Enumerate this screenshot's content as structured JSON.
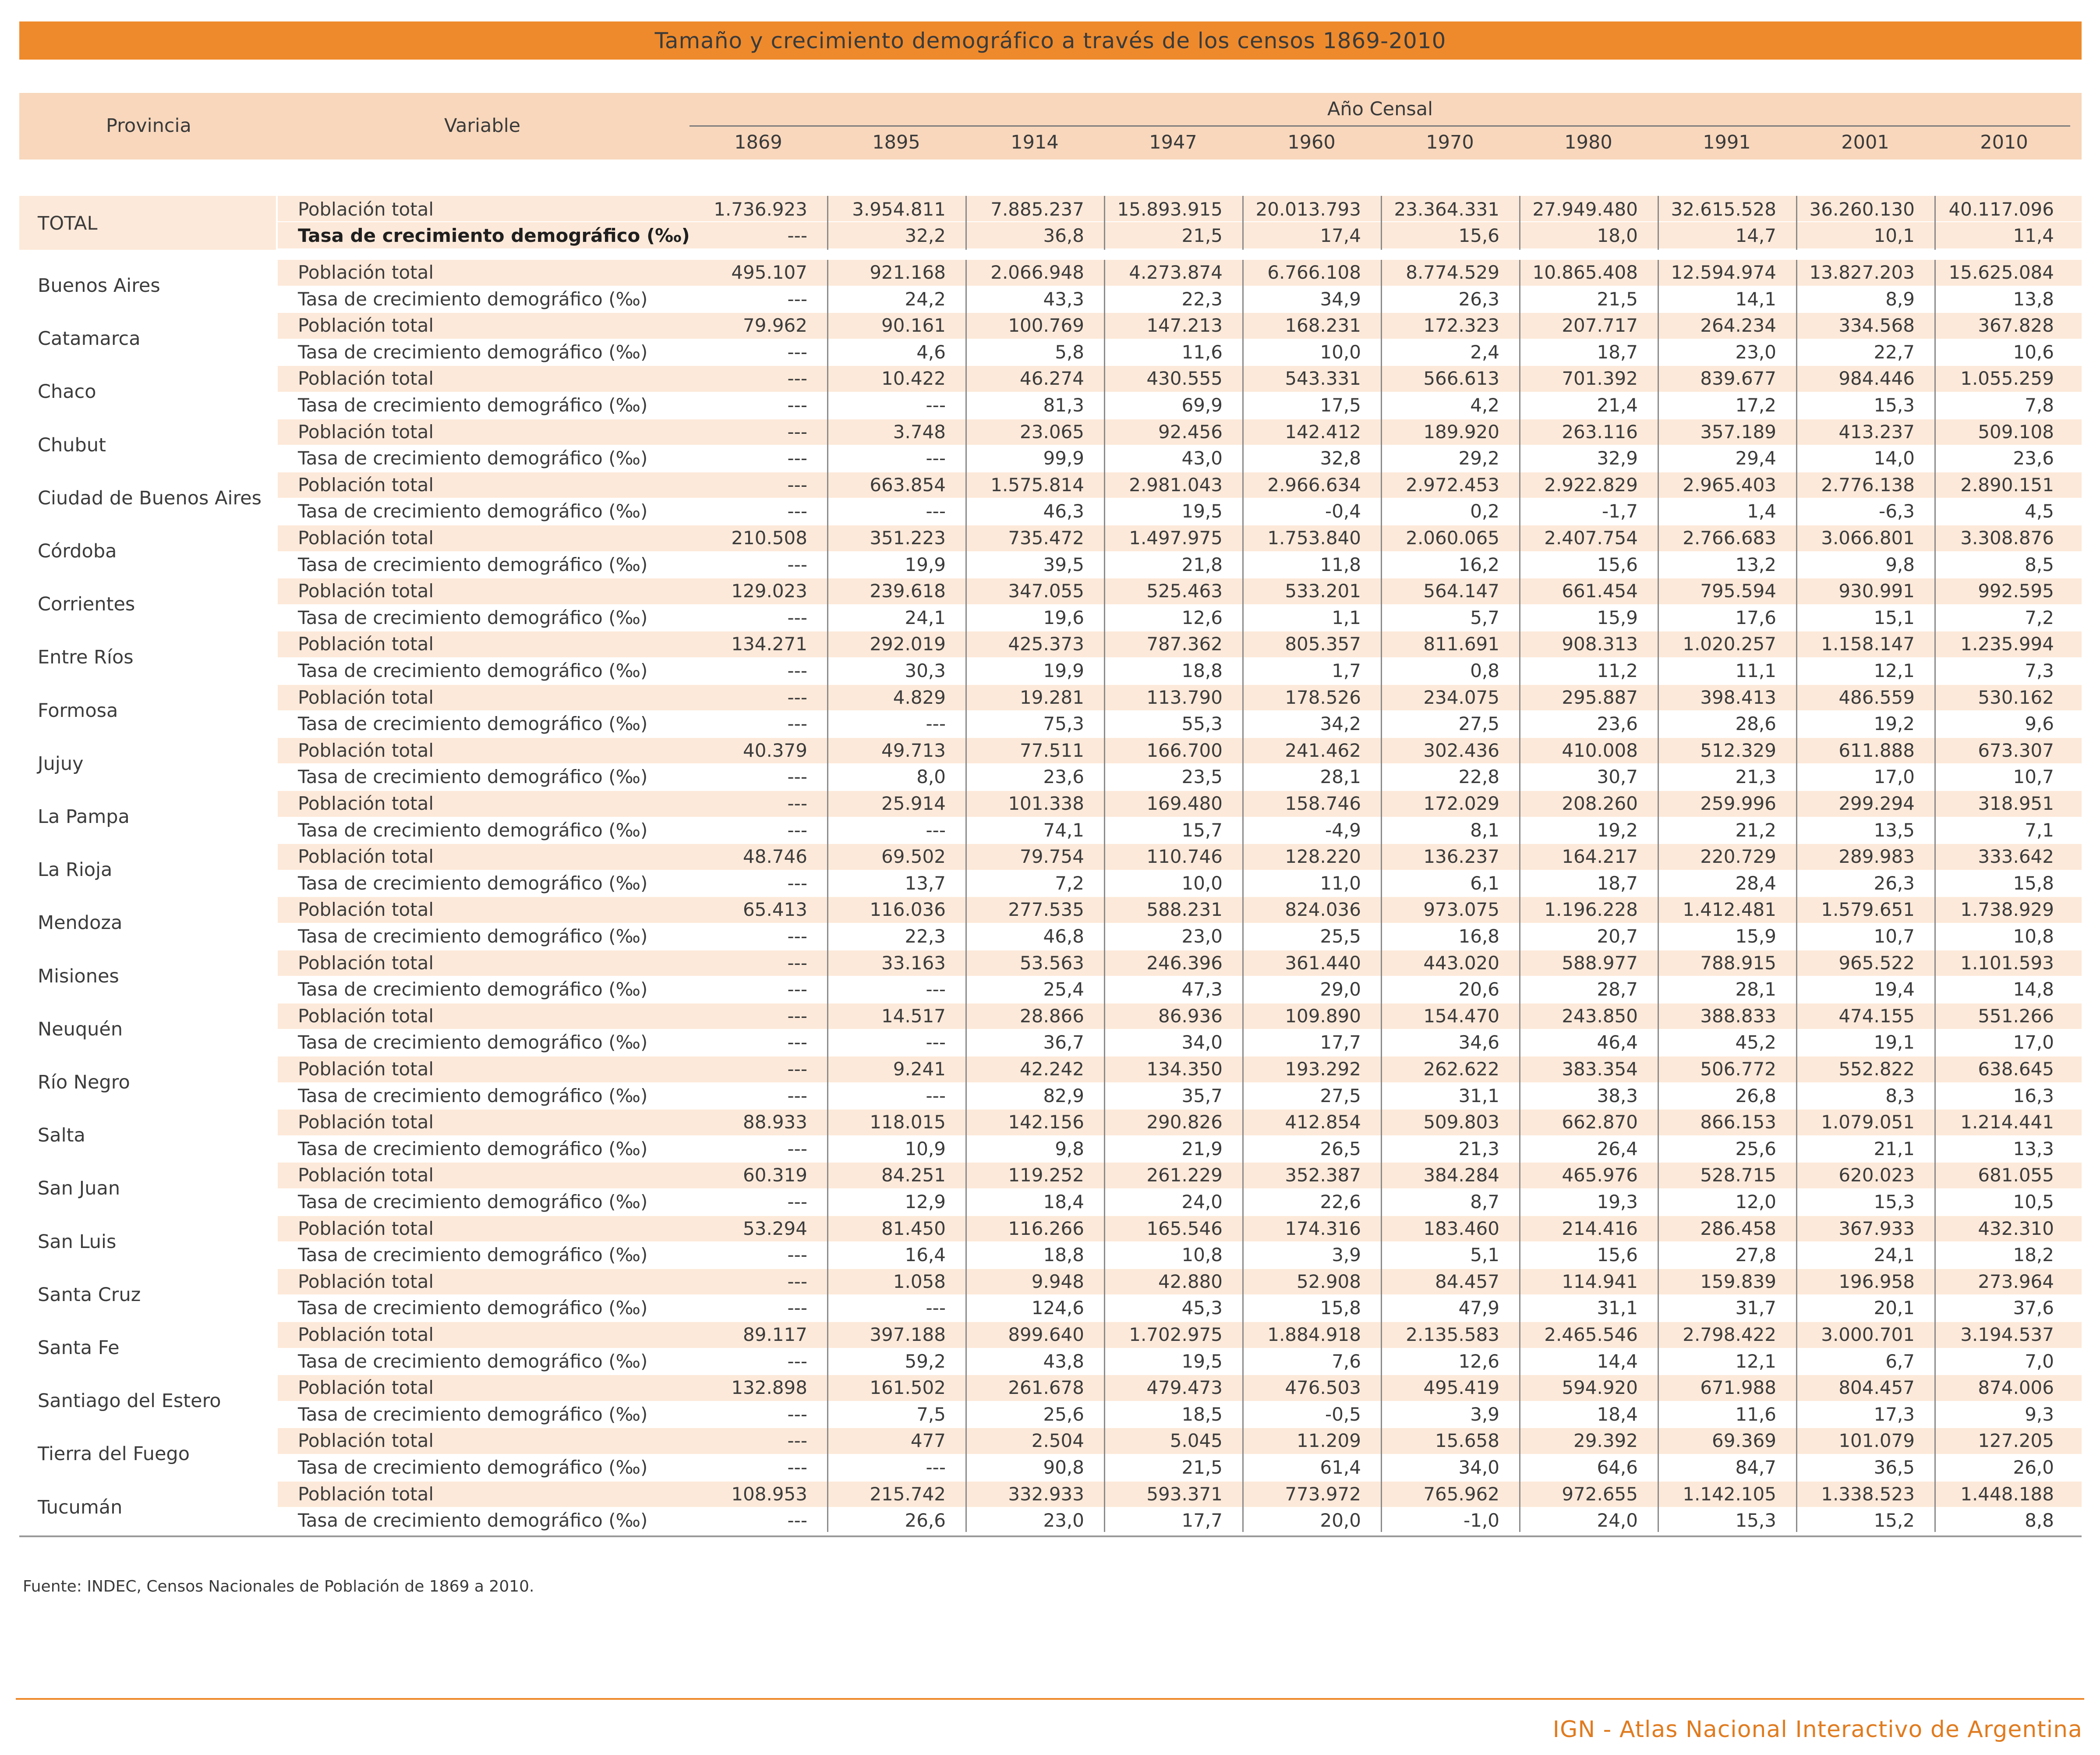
{
  "title": "Tamaño y crecimiento demográfico a través de los censos 1869-2010",
  "headers": {
    "province": "Provincia",
    "variable": "Variable",
    "year_group": "Año Censal",
    "years": [
      "1869",
      "1895",
      "1914",
      "1947",
      "1960",
      "1970",
      "1980",
      "1991",
      "2001",
      "2010"
    ]
  },
  "total": {
    "label": "TOTAL",
    "pop_label": "Población total",
    "rate_label": "Tasa de crecimiento demográfico (‰)",
    "pop": [
      "1.736.923",
      "3.954.811",
      "7.885.237",
      "15.893.915",
      "20.013.793",
      "23.364.331",
      "27.949.480",
      "32.615.528",
      "36.260.130",
      "40.117.096"
    ],
    "rate": [
      "---",
      "32,2",
      "36,8",
      "21,5",
      "17,4",
      "15,6",
      "18,0",
      "14,7",
      "10,1",
      "11,4"
    ]
  },
  "row_labels": {
    "pop": "Población total",
    "rate": "Tasa de crecimiento demográfico (‰)"
  },
  "provinces": [
    {
      "name": "Buenos Aires",
      "pop": [
        "495.107",
        "921.168",
        "2.066.948",
        "4.273.874",
        "6.766.108",
        "8.774.529",
        "10.865.408",
        "12.594.974",
        "13.827.203",
        "15.625.084"
      ],
      "rate": [
        "---",
        "24,2",
        "43,3",
        "22,3",
        "34,9",
        "26,3",
        "21,5",
        "14,1",
        "8,9",
        "13,8"
      ]
    },
    {
      "name": "Catamarca",
      "pop": [
        "79.962",
        "90.161",
        "100.769",
        "147.213",
        "168.231",
        "172.323",
        "207.717",
        "264.234",
        "334.568",
        "367.828"
      ],
      "rate": [
        "---",
        "4,6",
        "5,8",
        "11,6",
        "10,0",
        "2,4",
        "18,7",
        "23,0",
        "22,7",
        "10,6"
      ]
    },
    {
      "name": "Chaco",
      "pop": [
        "---",
        "10.422",
        "46.274",
        "430.555",
        "543.331",
        "566.613",
        "701.392",
        "839.677",
        "984.446",
        "1.055.259"
      ],
      "rate": [
        "---",
        "---",
        "81,3",
        "69,9",
        "17,5",
        "4,2",
        "21,4",
        "17,2",
        "15,3",
        "7,8"
      ]
    },
    {
      "name": "Chubut",
      "pop": [
        "---",
        "3.748",
        "23.065",
        "92.456",
        "142.412",
        "189.920",
        "263.116",
        "357.189",
        "413.237",
        "509.108"
      ],
      "rate": [
        "---",
        "---",
        "99,9",
        "43,0",
        "32,8",
        "29,2",
        "32,9",
        "29,4",
        "14,0",
        "23,6"
      ]
    },
    {
      "name": "Ciudad de Buenos Aires",
      "pop": [
        "---",
        "663.854",
        "1.575.814",
        "2.981.043",
        "2.966.634",
        "2.972.453",
        "2.922.829",
        "2.965.403",
        "2.776.138",
        "2.890.151"
      ],
      "rate": [
        "---",
        "---",
        "46,3",
        "19,5",
        "-0,4",
        "0,2",
        "-1,7",
        "1,4",
        "-6,3",
        "4,5"
      ]
    },
    {
      "name": "Córdoba",
      "pop": [
        "210.508",
        "351.223",
        "735.472",
        "1.497.975",
        "1.753.840",
        "2.060.065",
        "2.407.754",
        "2.766.683",
        "3.066.801",
        "3.308.876"
      ],
      "rate": [
        "---",
        "19,9",
        "39,5",
        "21,8",
        "11,8",
        "16,2",
        "15,6",
        "13,2",
        "9,8",
        "8,5"
      ]
    },
    {
      "name": "Corrientes",
      "pop": [
        "129.023",
        "239.618",
        "347.055",
        "525.463",
        "533.201",
        "564.147",
        "661.454",
        "795.594",
        "930.991",
        "992.595"
      ],
      "rate": [
        "---",
        "24,1",
        "19,6",
        "12,6",
        "1,1",
        "5,7",
        "15,9",
        "17,6",
        "15,1",
        "7,2"
      ]
    },
    {
      "name": "Entre Ríos",
      "pop": [
        "134.271",
        "292.019",
        "425.373",
        "787.362",
        "805.357",
        "811.691",
        "908.313",
        "1.020.257",
        "1.158.147",
        "1.235.994"
      ],
      "rate": [
        "---",
        "30,3",
        "19,9",
        "18,8",
        "1,7",
        "0,8",
        "11,2",
        "11,1",
        "12,1",
        "7,3"
      ]
    },
    {
      "name": "Formosa",
      "pop": [
        "---",
        "4.829",
        "19.281",
        "113.790",
        "178.526",
        "234.075",
        "295.887",
        "398.413",
        "486.559",
        "530.162"
      ],
      "rate": [
        "---",
        "---",
        "75,3",
        "55,3",
        "34,2",
        "27,5",
        "23,6",
        "28,6",
        "19,2",
        "9,6"
      ]
    },
    {
      "name": "Jujuy",
      "pop": [
        "40.379",
        "49.713",
        "77.511",
        "166.700",
        "241.462",
        "302.436",
        "410.008",
        "512.329",
        "611.888",
        "673.307"
      ],
      "rate": [
        "---",
        "8,0",
        "23,6",
        "23,5",
        "28,1",
        "22,8",
        "30,7",
        "21,3",
        "17,0",
        "10,7"
      ]
    },
    {
      "name": "La Pampa",
      "pop": [
        "---",
        "25.914",
        "101.338",
        "169.480",
        "158.746",
        "172.029",
        "208.260",
        "259.996",
        "299.294",
        "318.951"
      ],
      "rate": [
        "---",
        "---",
        "74,1",
        "15,7",
        "-4,9",
        "8,1",
        "19,2",
        "21,2",
        "13,5",
        "7,1"
      ]
    },
    {
      "name": "La Rioja",
      "pop": [
        "48.746",
        "69.502",
        "79.754",
        "110.746",
        "128.220",
        "136.237",
        "164.217",
        "220.729",
        "289.983",
        "333.642"
      ],
      "rate": [
        "---",
        "13,7",
        "7,2",
        "10,0",
        "11,0",
        "6,1",
        "18,7",
        "28,4",
        "26,3",
        "15,8"
      ]
    },
    {
      "name": "Mendoza",
      "pop": [
        "65.413",
        "116.036",
        "277.535",
        "588.231",
        "824.036",
        "973.075",
        "1.196.228",
        "1.412.481",
        "1.579.651",
        "1.738.929"
      ],
      "rate": [
        "---",
        "22,3",
        "46,8",
        "23,0",
        "25,5",
        "16,8",
        "20,7",
        "15,9",
        "10,7",
        "10,8"
      ]
    },
    {
      "name": "Misiones",
      "pop": [
        "---",
        "33.163",
        "53.563",
        "246.396",
        "361.440",
        "443.020",
        "588.977",
        "788.915",
        "965.522",
        "1.101.593"
      ],
      "rate": [
        "---",
        "---",
        "25,4",
        "47,3",
        "29,0",
        "20,6",
        "28,7",
        "28,1",
        "19,4",
        "14,8"
      ]
    },
    {
      "name": "Neuquén",
      "pop": [
        "---",
        "14.517",
        "28.866",
        "86.936",
        "109.890",
        "154.470",
        "243.850",
        "388.833",
        "474.155",
        "551.266"
      ],
      "rate": [
        "---",
        "---",
        "36,7",
        "34,0",
        "17,7",
        "34,6",
        "46,4",
        "45,2",
        "19,1",
        "17,0"
      ]
    },
    {
      "name": "Río Negro",
      "pop": [
        "---",
        "9.241",
        "42.242",
        "134.350",
        "193.292",
        "262.622",
        "383.354",
        "506.772",
        "552.822",
        "638.645"
      ],
      "rate": [
        "---",
        "---",
        "82,9",
        "35,7",
        "27,5",
        "31,1",
        "38,3",
        "26,8",
        "8,3",
        "16,3"
      ]
    },
    {
      "name": "Salta",
      "pop": [
        "88.933",
        "118.015",
        "142.156",
        "290.826",
        "412.854",
        "509.803",
        "662.870",
        "866.153",
        "1.079.051",
        "1.214.441"
      ],
      "rate": [
        "---",
        "10,9",
        "9,8",
        "21,9",
        "26,5",
        "21,3",
        "26,4",
        "25,6",
        "21,1",
        "13,3"
      ]
    },
    {
      "name": "San Juan",
      "pop": [
        "60.319",
        "84.251",
        "119.252",
        "261.229",
        "352.387",
        "384.284",
        "465.976",
        "528.715",
        "620.023",
        "681.055"
      ],
      "rate": [
        "---",
        "12,9",
        "18,4",
        "24,0",
        "22,6",
        "8,7",
        "19,3",
        "12,0",
        "15,3",
        "10,5"
      ]
    },
    {
      "name": "San Luis",
      "pop": [
        "53.294",
        "81.450",
        "116.266",
        "165.546",
        "174.316",
        "183.460",
        "214.416",
        "286.458",
        "367.933",
        "432.310"
      ],
      "rate": [
        "---",
        "16,4",
        "18,8",
        "10,8",
        "3,9",
        "5,1",
        "15,6",
        "27,8",
        "24,1",
        "18,2"
      ]
    },
    {
      "name": "Santa Cruz",
      "pop": [
        "---",
        "1.058",
        "9.948",
        "42.880",
        "52.908",
        "84.457",
        "114.941",
        "159.839",
        "196.958",
        "273.964"
      ],
      "rate": [
        "---",
        "---",
        "124,6",
        "45,3",
        "15,8",
        "47,9",
        "31,1",
        "31,7",
        "20,1",
        "37,6"
      ]
    },
    {
      "name": "Santa Fe",
      "pop": [
        "89.117",
        "397.188",
        "899.640",
        "1.702.975",
        "1.884.918",
        "2.135.583",
        "2.465.546",
        "2.798.422",
        "3.000.701",
        "3.194.537"
      ],
      "rate": [
        "---",
        "59,2",
        "43,8",
        "19,5",
        "7,6",
        "12,6",
        "14,4",
        "12,1",
        "6,7",
        "7,0"
      ]
    },
    {
      "name": "Santiago del Estero",
      "pop": [
        "132.898",
        "161.502",
        "261.678",
        "479.473",
        "476.503",
        "495.419",
        "594.920",
        "671.988",
        "804.457",
        "874.006"
      ],
      "rate": [
        "---",
        "7,5",
        "25,6",
        "18,5",
        "-0,5",
        "3,9",
        "18,4",
        "11,6",
        "17,3",
        "9,3"
      ]
    },
    {
      "name": "Tierra del Fuego",
      "pop": [
        "---",
        "477",
        "2.504",
        "5.045",
        "11.209",
        "15.658",
        "29.392",
        "69.369",
        "101.079",
        "127.205"
      ],
      "rate": [
        "---",
        "---",
        "90,8",
        "21,5",
        "61,4",
        "34,0",
        "64,6",
        "84,7",
        "36,5",
        "26,0"
      ]
    },
    {
      "name": "Tucumán",
      "pop": [
        "108.953",
        "215.742",
        "332.933",
        "593.371",
        "773.972",
        "765.962",
        "972.655",
        "1.142.105",
        "1.338.523",
        "1.448.188"
      ],
      "rate": [
        "---",
        "26,6",
        "23,0",
        "17,7",
        "20,0",
        "-1,0",
        "24,0",
        "15,3",
        "15,2",
        "8,8"
      ]
    }
  ],
  "source": "Fuente: INDEC, Censos Nacionales de Población de 1869 a 2010.",
  "footer": "IGN - Atlas Nacional Interactivo de Argentina"
}
